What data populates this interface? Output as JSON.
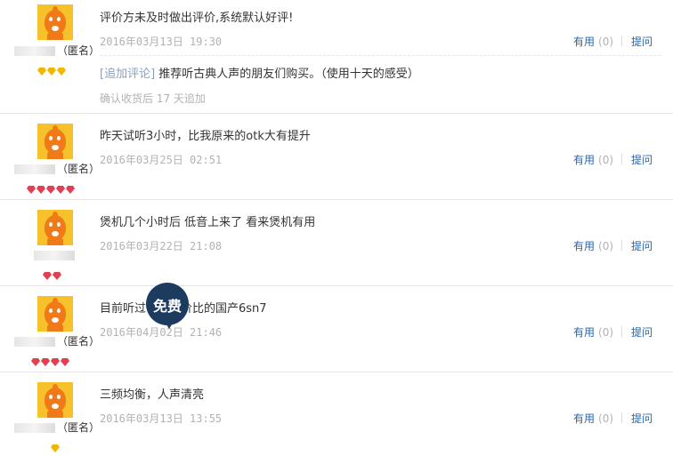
{
  "reviews": [
    {
      "username_suffix": "（匿名）",
      "rank_gems": "yellow3",
      "content": "评价方未及时做出评价,系统默认好评!",
      "date": "2016年03月13日 19:30",
      "append_label": "[追加评论]",
      "append_text": "推荐听古典人声的朋友们购买。（使用十天的感受）",
      "append_note": "确认收货后 17 天追加",
      "useful_label": "有用",
      "useful_count": "(0)",
      "ask_label": "提问"
    },
    {
      "username_suffix": "（匿名）",
      "rank_gems": "red5",
      "content": "昨天试听3小时，比我原来的otk大有提升",
      "date": "2016年03月25日 02:51",
      "useful_label": "有用",
      "useful_count": "(0)",
      "ask_label": "提问"
    },
    {
      "username_suffix": "",
      "rank_gems": "red2",
      "content": "煲机几个小时后 低音上来了 看来煲机有用",
      "date": "2016年03月22日 21:08",
      "useful_label": "有用",
      "useful_count": "(0)",
      "ask_label": "提问"
    },
    {
      "username_suffix": "（匿名）",
      "rank_gems": "red4",
      "content": "目前听过　　　价比的国产6sn7",
      "date": "2016年04月02日 21:46",
      "useful_label": "有用",
      "useful_count": "(0)",
      "ask_label": "提问"
    },
    {
      "username_suffix": "（匿名）",
      "rank_gems": "yellow1",
      "content": "三频均衡，人声清亮",
      "date": "2016年03月13日 13:55",
      "useful_label": "有用",
      "useful_count": "(0)",
      "ask_label": "提问"
    }
  ],
  "overlay_badge": "免费",
  "colors": {
    "link": "#2a64a8",
    "muted": "#b2b2b2",
    "gem_red": "#e04050",
    "gem_yellow": "#f2b800",
    "badge": "#1c3b5e"
  }
}
